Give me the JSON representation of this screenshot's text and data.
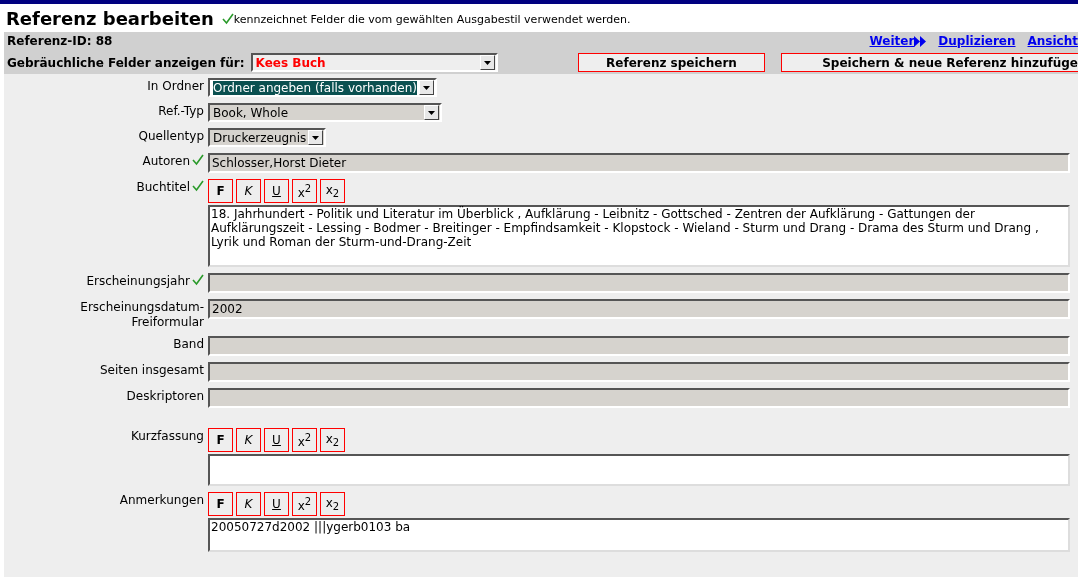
{
  "header": {
    "title": "Referenz bearbeiten",
    "legend": "kennzeichnet Felder die vom gewählten Ausgabestil verwendet werden."
  },
  "toolbar": {
    "reference_id": "Referenz-ID: 88",
    "links": [
      {
        "label": "Weiter",
        "arrow": true
      },
      {
        "label": "Duplizieren",
        "arrow": false
      },
      {
        "label": "Ansicht",
        "arrow": false
      }
    ],
    "common_fields_label": "Gebräuchliche Felder anzeigen für:",
    "common_fields_value": "Kees Buch",
    "buttons": [
      "Referenz speichern",
      "Speichern & neue Referenz hinzufüge"
    ]
  },
  "fields": [
    {
      "kind": "select",
      "label": "In Ordner",
      "checked": false,
      "value": "Ordner angeben (falls vorhanden)",
      "focused": true
    },
    {
      "kind": "select",
      "label": "Ref.-Typ",
      "checked": false,
      "value": "Book, Whole",
      "focused": false
    },
    {
      "kind": "select",
      "label": "Quellentyp",
      "checked": false,
      "value": "Druckerzeugnis",
      "focused": false
    },
    {
      "kind": "input",
      "label": "Autoren",
      "checked": true,
      "value": "Schlosser,Horst Dieter"
    },
    {
      "kind": "textarea",
      "label": "Buchtitel",
      "checked": true,
      "value": "18. Jahrhundert - Politik und Literatur im Überblick , Aufklärung - Leibnitz - Gottsched - Zentren der Aufklärung - Gattungen der Aufklärungszeit - Lessing - Bodmer - Breitinger - Empfindsamkeit - Klopstock - Wieland - Sturm und Drang - Drama des Sturm und Drang , Lyrik und Roman der Sturm-und-Drang-Zeit",
      "format_buttons": [
        "F",
        "K",
        "U",
        "x$^{2}$",
        "x$_{2}$"
      ]
    },
    {
      "kind": "input",
      "label": "Erscheinungsjahr",
      "checked": true
    },
    {
      "kind": "input",
      "label": "Erscheinungsdatum-Freiformular",
      "checked": false,
      "value": "2002"
    },
    {
      "kind": "input",
      "label": "Band",
      "checked": false
    },
    {
      "kind": "input",
      "label": "Seiten insgesamt",
      "checked": false
    },
    {
      "kind": "input",
      "label": "Deskriptoren",
      "checked": false
    },
    {
      "kind": "textarea",
      "label": "Kurzfassung",
      "checked": false,
      "format_buttons": [
        "F",
        "K",
        "U",
        "x$^{2}$",
        "x$_{2}$"
      ]
    },
    {
      "kind": "textarea",
      "label": "Anmerkungen",
      "checked": false,
      "value": "20050727d2002 |||ygerb0103 ba",
      "format_buttons": [
        "F",
        "K",
        "U",
        "x$^{2}$",
        "x$_{2}$"
      ]
    }
  ]
}
